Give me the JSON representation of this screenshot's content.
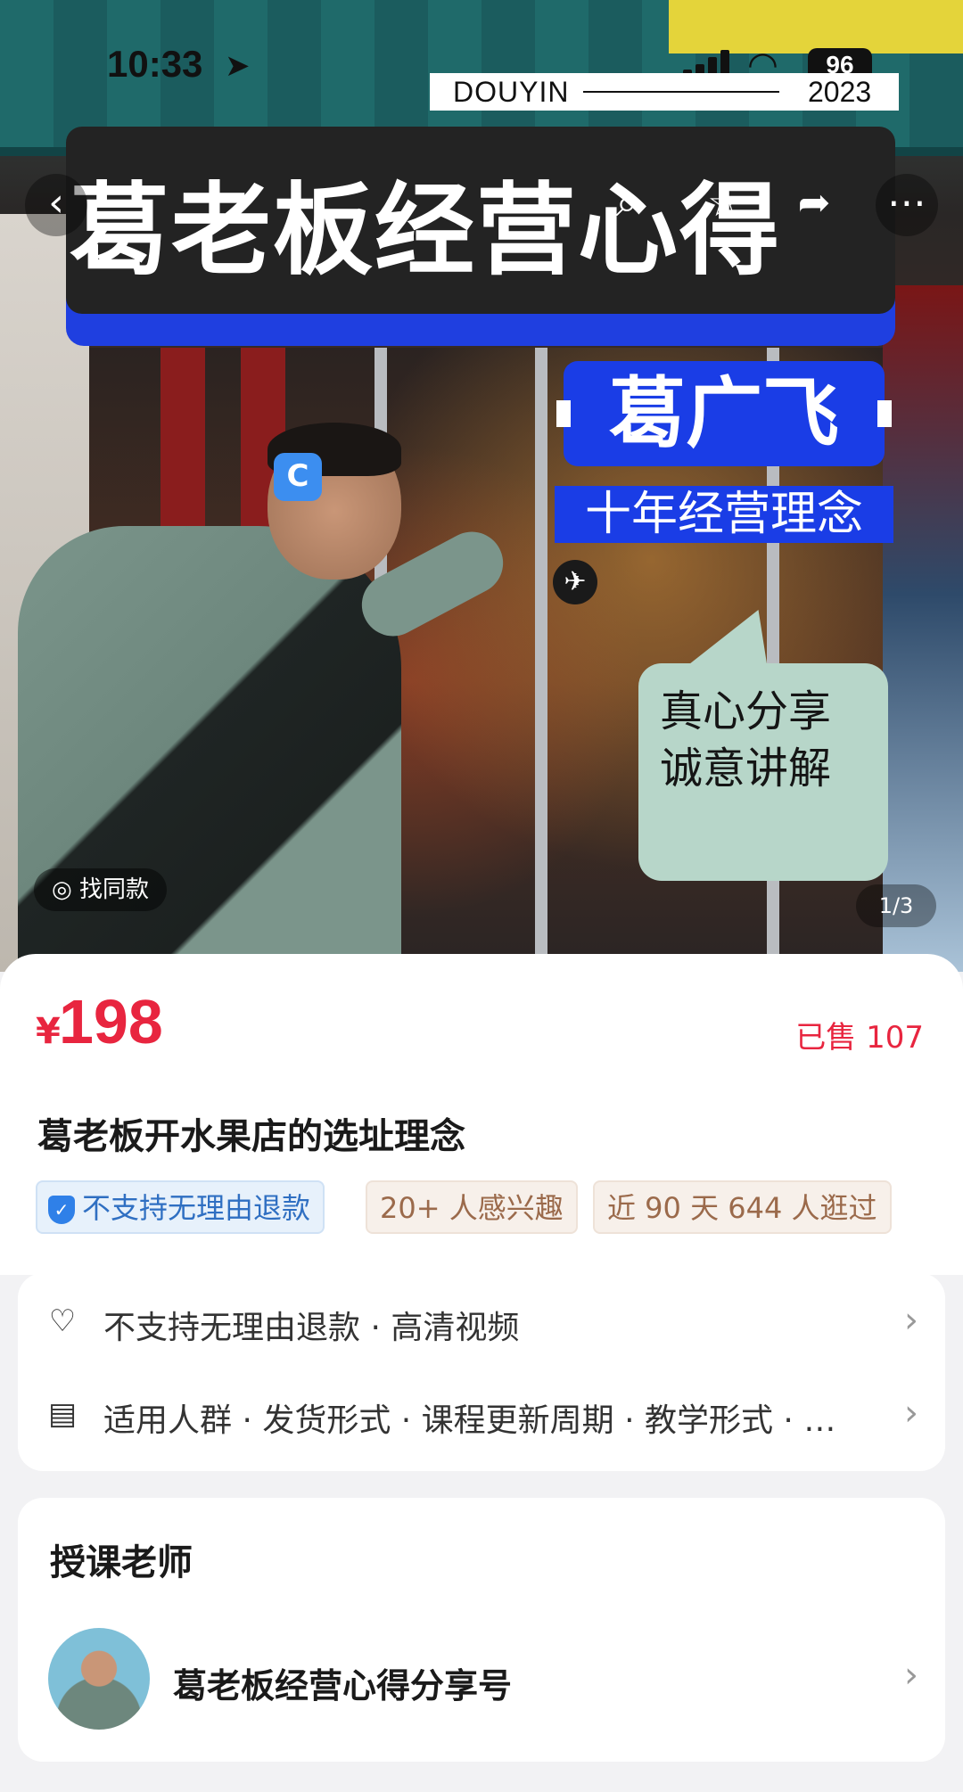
{
  "status_bar": {
    "time": "10:33",
    "battery": "96"
  },
  "watermark_strip": {
    "left": "DOUYIN",
    "right": "2023"
  },
  "hero": {
    "title": "葛老板经营心得",
    "name": "葛广飞",
    "subtitle": "十年经营理念",
    "bubble_line1": "真心分享",
    "bubble_line2": "诚意讲解",
    "find_similar": "找同款",
    "pager": "1/3",
    "icons": {
      "back": "chevron-left-icon",
      "search": "search-icon",
      "favorite": "star-icon",
      "share": "share-icon",
      "more": "more-icon",
      "plane": "plane-icon"
    }
  },
  "product": {
    "currency": "¥",
    "price": "198",
    "sold": "已售 107",
    "title": "葛老板开水果店的选址理念",
    "tags": {
      "refund": "不支持无理由退款",
      "interest": "20+ 人感兴趣",
      "visited": "近 90 天 644 人逛过"
    }
  },
  "details": {
    "row1": "不支持无理由退款 · 高清视频",
    "row2": "适用人群 · 发货形式 · 课程更新周期 · 教学形式 · …"
  },
  "teacher": {
    "heading": "授课老师",
    "name": "葛老板经营心得分享号"
  },
  "colors": {
    "price_red": "#e8253f",
    "banner_blue": "#1a3de6",
    "bubble_green": "#b7d6c9"
  }
}
